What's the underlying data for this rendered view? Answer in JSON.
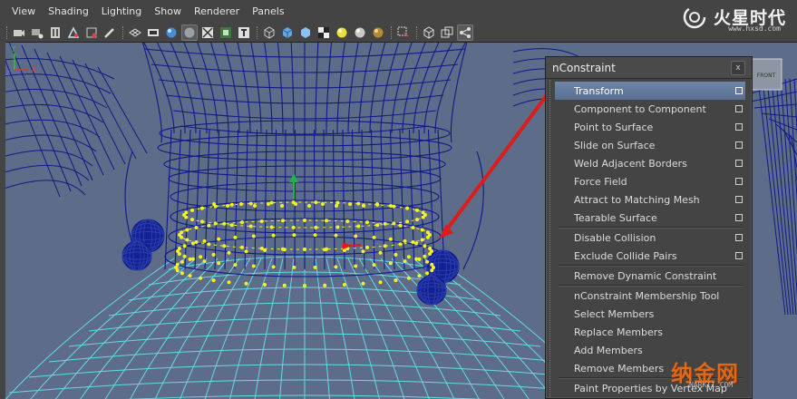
{
  "menubar": {
    "items": [
      "View",
      "Shading",
      "Lighting",
      "Show",
      "Renderer",
      "Panels"
    ]
  },
  "logo": {
    "brand": "火星时代",
    "url": "www.hxsd.com"
  },
  "toolbar": {
    "icons": [
      "camera-select-icon",
      "camera-attributes-icon",
      "bookmark-icon",
      "image-plane-icon",
      "two-d-pan-icon",
      "grease-pencil-icon",
      "grid-icon",
      "film-gate-icon",
      "resolution-gate-icon",
      "field-chart-icon",
      "safe-action-icon",
      "safe-title-icon",
      "wireframe-icon",
      "smooth-shade-icon",
      "default-material-icon",
      "textured-icon",
      "use-all-lights-icon",
      "shadows-icon",
      "ambient-occlusion-icon",
      "isolate-select-icon",
      "xray-icon",
      "xray-joints-icon",
      "xray-active-icon"
    ]
  },
  "viewport": {
    "axis": {
      "x": "X",
      "y": "Y",
      "z": "Z"
    },
    "view_cube_label": "FRONT",
    "colors": {
      "background": "#5d6c88",
      "wire": "#0f1a86",
      "wire_selected": "#62dbe6",
      "points": "#f4f227",
      "arrow": "#dd1c1c"
    }
  },
  "nconstraint": {
    "title": "nConstraint",
    "close": "x",
    "groups": [
      [
        {
          "label": "Transform",
          "highlighted": true,
          "option_box": true
        },
        {
          "label": "Component to Component",
          "option_box": true
        },
        {
          "label": "Point to Surface",
          "option_box": true
        },
        {
          "label": "Slide on Surface",
          "option_box": true
        },
        {
          "label": "Weld Adjacent Borders",
          "option_box": true
        },
        {
          "label": "Force Field",
          "option_box": true
        },
        {
          "label": "Attract to Matching Mesh",
          "option_box": true
        },
        {
          "label": "Tearable Surface",
          "option_box": true
        }
      ],
      [
        {
          "label": "Disable Collision",
          "option_box": true
        },
        {
          "label": "Exclude Collide Pairs",
          "option_box": true
        }
      ],
      [
        {
          "label": "Remove Dynamic Constraint",
          "option_box": false
        }
      ],
      [
        {
          "label": "nConstraint Membership Tool",
          "option_box": false
        },
        {
          "label": "Select Members",
          "option_box": false
        },
        {
          "label": "Replace Members",
          "option_box": false
        },
        {
          "label": "Add Members",
          "option_box": false
        },
        {
          "label": "Remove Members",
          "option_box": false
        }
      ],
      [
        {
          "label": "Paint Properties by Vertex Map",
          "option_box": false
        }
      ]
    ]
  },
  "watermark": {
    "text": "纳金网",
    "sub": "NARKII.COM"
  }
}
